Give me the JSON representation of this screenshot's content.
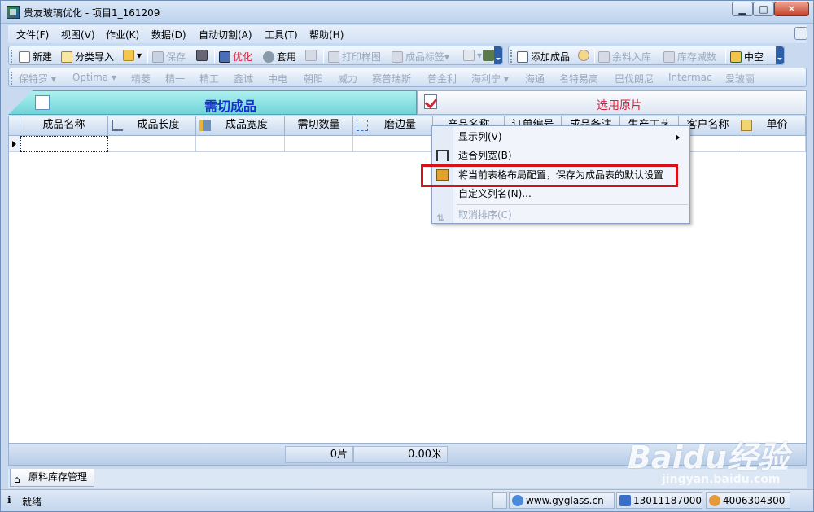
{
  "window": {
    "title": "贵友玻璃优化 - 项目1_161209"
  },
  "menu": [
    "文件(F)",
    "视图(V)",
    "作业(K)",
    "数据(D)",
    "自动切割(A)",
    "工具(T)",
    "帮助(H)"
  ],
  "toolbar1": {
    "new": "新建",
    "import": "分类导入",
    "save": "保存",
    "optimize": "优化",
    "nest": "套用",
    "print": "打印样图",
    "label": "成品标签"
  },
  "toolbar2": {
    "add_product": "添加成品",
    "remnant_in": "余料入库",
    "stock_reduce": "库存减数",
    "insulated": "中空"
  },
  "toolbar3": [
    "保特罗",
    "Optima",
    "精菱",
    "精一",
    "精工",
    "鑫诚",
    "中电",
    "朝阳",
    "威力",
    "赛普瑞斯",
    "普金利",
    "海利宁",
    "海通",
    "名特易高",
    "巴伐朗尼",
    "Intermac",
    "爱玻丽"
  ],
  "tabs": {
    "left": "需切成品",
    "right": "选用原片"
  },
  "grid": {
    "headers": [
      "成品名称",
      "成品长度",
      "成品宽度",
      "需切数量",
      "磨边量",
      "产品名称",
      "订单编号",
      "成品备注",
      "生产工艺",
      "客户名称",
      "单价"
    ],
    "footer_count": "0片",
    "footer_length": "0.00米"
  },
  "context_menu": {
    "show_columns": "显示列(V)",
    "fit_width": "适合列宽(B)",
    "save_default": "将当前表格布局配置，保存为成品表的默认设置",
    "custom_names": "自定义列名(N)...",
    "cancel_sort": "取消排序(C)"
  },
  "bottom_tab": "原料库存管理",
  "status": {
    "ready": "就绪",
    "website": "www.gyglass.cn",
    "phone": "13011187000",
    "hotline": "4006304300"
  },
  "watermark": {
    "brand": "Baidu经验",
    "url": "jingyan.baidu.com"
  },
  "colors": {
    "highlight": "#d8101a",
    "tab_left": "#6fd5d8",
    "tab_left_text": "#1a2fd0",
    "tab_right_text": "#d0223a"
  }
}
